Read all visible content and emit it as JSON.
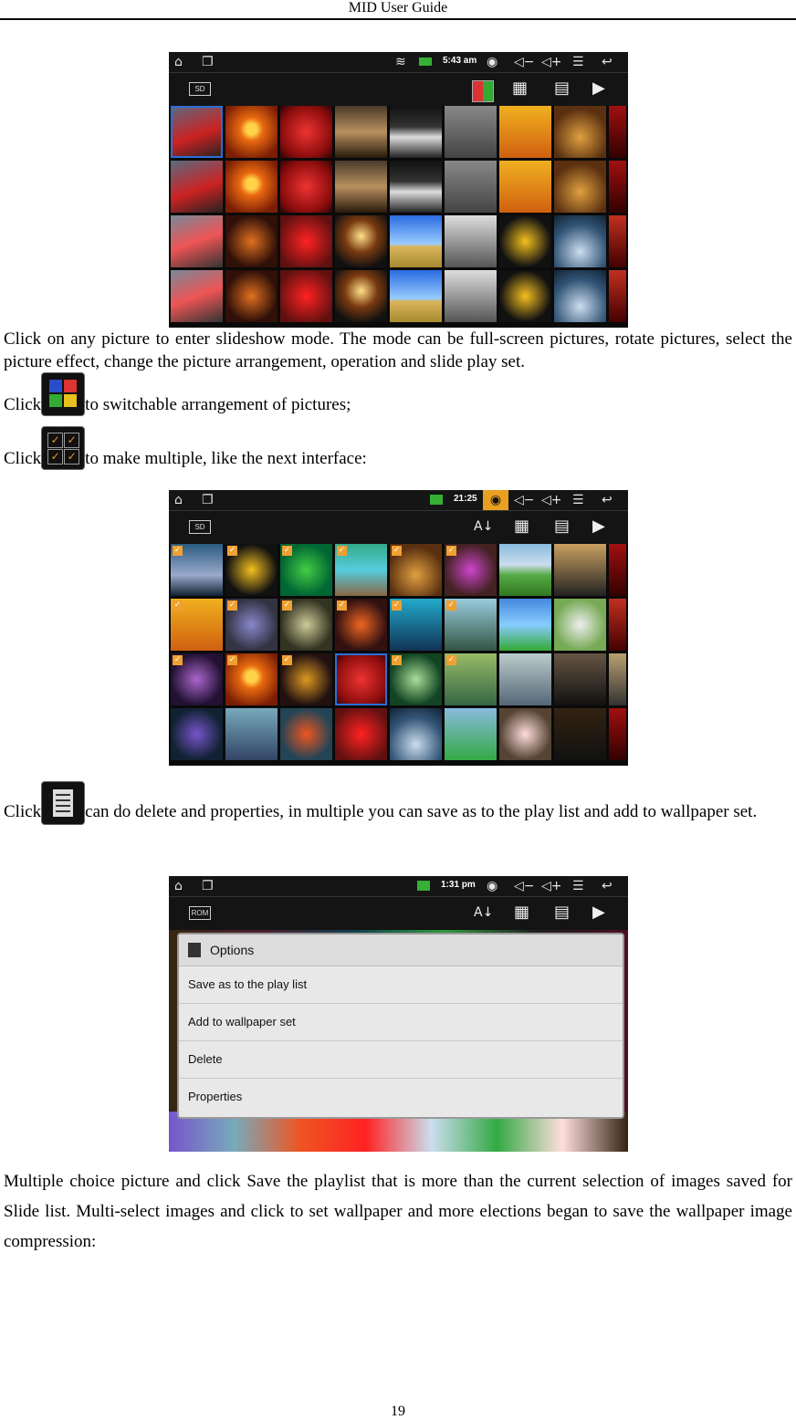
{
  "header": {
    "title": "MID User Guide"
  },
  "page_number": "19",
  "paragraphs": {
    "p1": "Click on any picture to enter slideshow mode. The mode can be full-screen pictures, rotate pictures, select the picture effect, change the picture arrangement, operation and slide play set.",
    "p2_prefix": "Click",
    "p2_suffix": "to switchable arrangement of pictures;",
    "p3_prefix": "Click",
    "p3_suffix": "to make multiple, like the next interface:",
    "p4_prefix": "Click",
    "p4_suffix": "can do delete and properties, in multiple you can save as to the play list and add to wallpaper set.",
    "p5": "Multiple choice picture and click Save the playlist that is more than the current selection of images saved for Slide list. Multi-select images and click to set wallpaper and more elections began to save the wallpaper image compression:"
  },
  "screens": [
    {
      "time": "5:43 am",
      "storage": "SD"
    },
    {
      "time": "21:25",
      "storage": "SD"
    },
    {
      "time": "1:31 pm",
      "storage": "ROM"
    }
  ],
  "options_dialog": {
    "title": "Options",
    "items": [
      "Save as to the play list",
      "Add to wallpaper set",
      "Delete",
      "Properties"
    ]
  },
  "icons": {
    "statusbar": [
      "home-icon",
      "window-icon",
      "wifi-icon",
      "battery-icon",
      "eye-icon",
      "volume-down-icon",
      "volume-up-icon",
      "menu-icon",
      "back-icon"
    ],
    "toolbar": [
      "sd-card-icon",
      "arrangement-icon",
      "multi-select-icon",
      "options-icon",
      "play-icon"
    ]
  }
}
